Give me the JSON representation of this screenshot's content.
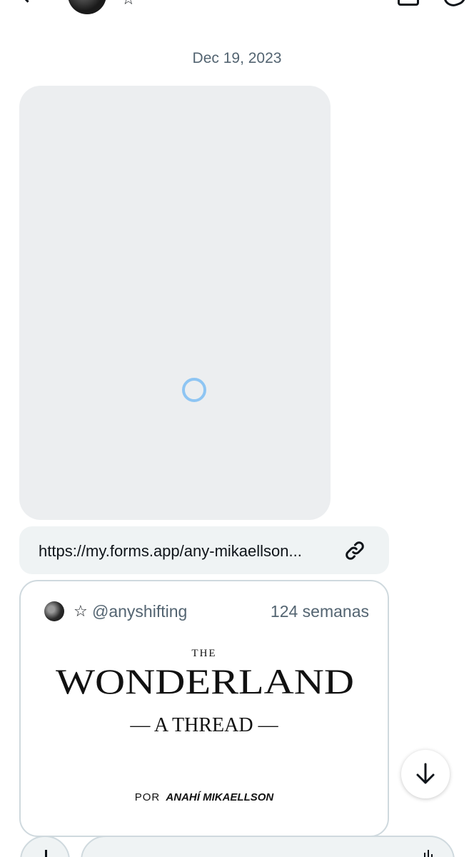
{
  "header": {
    "star_symbol": "☆"
  },
  "conversation": {
    "date_label": "Dec 19, 2023"
  },
  "link_message": {
    "url_text": "https://my.forms.app/any-mikaellson..."
  },
  "quoted_post": {
    "star_symbol": "☆",
    "handle": "@anyshifting",
    "time_ago": "124 semanas",
    "image_text": {
      "the": "THE",
      "title": "WONDERLAND",
      "subtitle": "— A THREAD —",
      "by": "POR",
      "author": "ANAHÍ MIKAELLSON"
    }
  },
  "icons": {
    "back": "arrow-left-icon",
    "link": "link-icon",
    "scroll": "arrow-down-icon",
    "add": "plus-icon",
    "spinner": "loading-spinner-icon",
    "mic": "voice-icon"
  },
  "colors": {
    "accent_spinner": "#8ec5f3",
    "muted_text": "#536471",
    "bubble_bg": "#eff3f4",
    "media_placeholder": "#eceef0"
  }
}
